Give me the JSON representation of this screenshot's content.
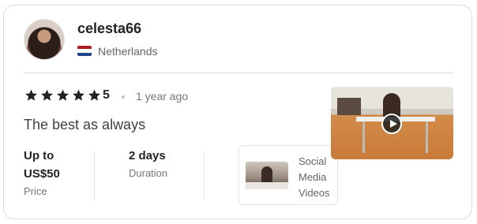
{
  "reviewer": {
    "username": "celesta66",
    "country": "Netherlands",
    "flag_colors": [
      "#ae1c28",
      "#ffffff",
      "#21468b"
    ]
  },
  "review": {
    "rating": "5",
    "stars": 5,
    "time_ago": "1 year ago",
    "text": "The best as always"
  },
  "stats": {
    "price_value": "Up to US$50",
    "price_label": "Price",
    "duration_value": "2 days",
    "duration_label": "Duration"
  },
  "gig": {
    "title": "Social Media Videos"
  },
  "media": {
    "type": "video",
    "icon": "play-icon"
  },
  "colors": {
    "star": "#222325",
    "text_primary": "#222325",
    "text_secondary": "#74767e"
  }
}
